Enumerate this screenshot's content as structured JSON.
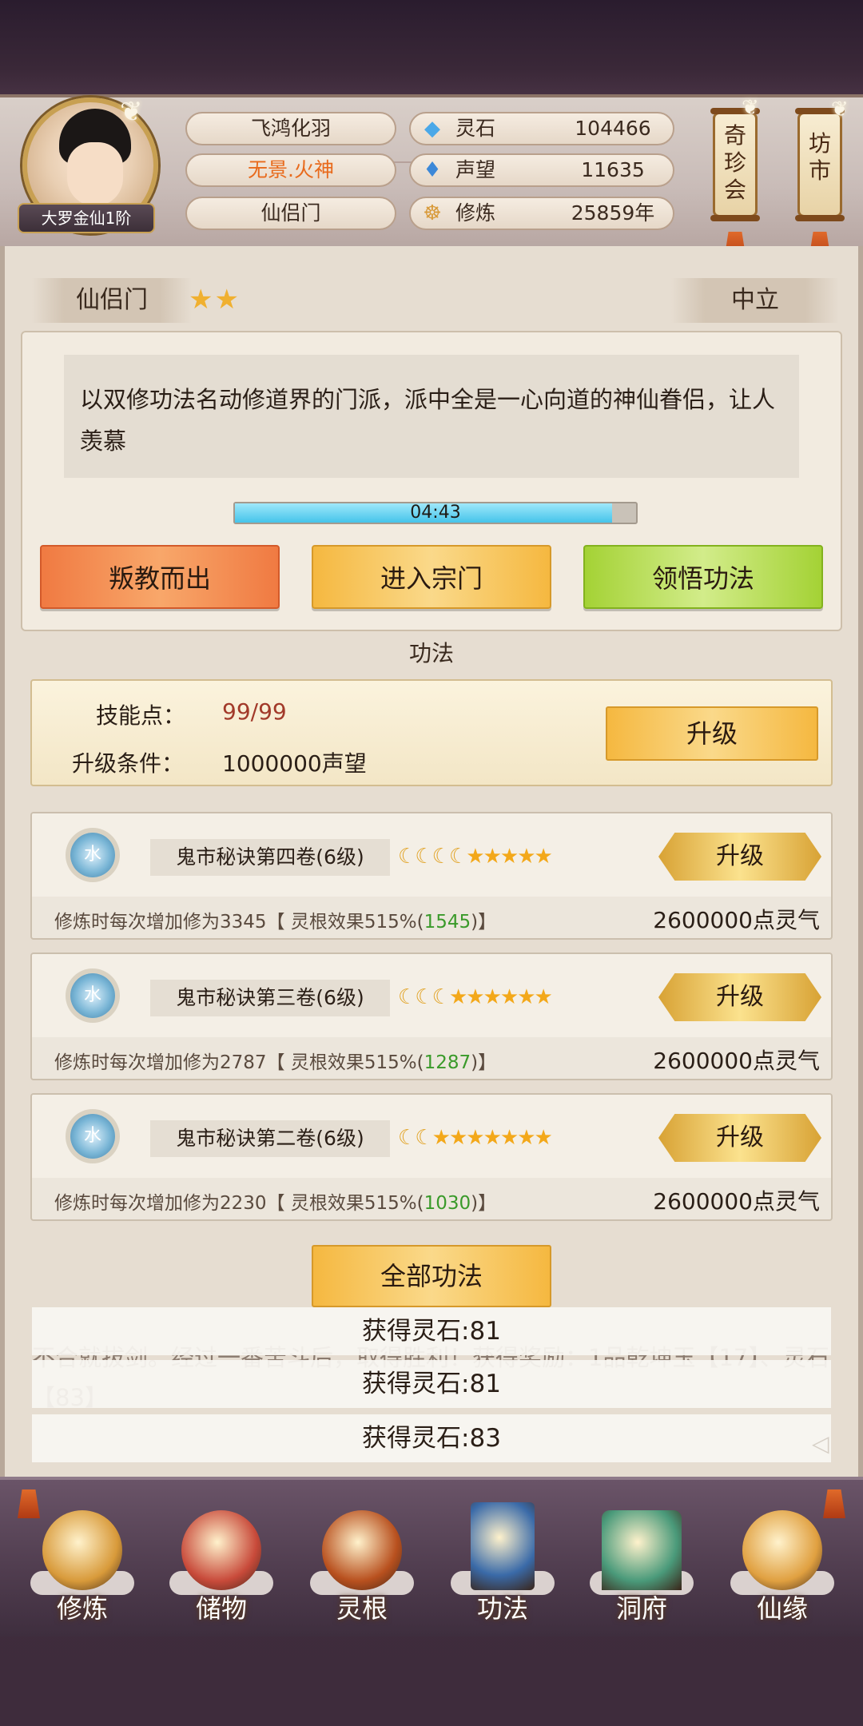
{
  "player": {
    "rank": "大罗金仙1阶",
    "title": "飞鸿化羽",
    "name": "无景.火神",
    "sect": "仙侣门"
  },
  "resources": [
    {
      "icon": "gem-icon",
      "label": "灵石",
      "value": "104466"
    },
    {
      "icon": "reputation-icon",
      "label": "声望",
      "value": "11635"
    },
    {
      "icon": "meditation-icon",
      "label": "修炼",
      "value": "25859年"
    }
  ],
  "side_buttons": {
    "treasure": "奇珍会",
    "market": "坊市"
  },
  "sect": {
    "name": "仙侣门",
    "stars": "★★",
    "alignment": "中立",
    "description": "以双修功法名动修道界的门派，派中全是一心向道的神仙眷侣，让人羡慕",
    "timer": "04:43",
    "progress": 0.94,
    "buttons": {
      "betray": "叛教而出",
      "enter": "进入宗门",
      "learn": "领悟功法"
    }
  },
  "gongfa": {
    "section_title": "功法",
    "skill_points_label": "技能点：",
    "skill_points_value": "99/99",
    "condition_label": "升级条件：",
    "condition_value": "1000000声望",
    "upgrade_label": "升级"
  },
  "techniques": [
    {
      "element": "水",
      "name": "鬼市秘诀第四卷(6级)",
      "moons": 4,
      "stars": 5,
      "upgrade": "升级",
      "desc_prefix": "修炼时每次增加修为3345【 灵根效果515%(",
      "desc_green": "1545",
      "desc_suffix": ")】",
      "cost": "2600000点灵气"
    },
    {
      "element": "水",
      "name": "鬼市秘诀第三卷(6级)",
      "moons": 3,
      "stars": 6,
      "upgrade": "升级",
      "desc_prefix": "修炼时每次增加修为2787【 灵根效果515%(",
      "desc_green": "1287",
      "desc_suffix": ")】",
      "cost": "2600000点灵气"
    },
    {
      "element": "水",
      "name": "鬼市秘诀第二卷(6级)",
      "moons": 2,
      "stars": 7,
      "upgrade": "升级",
      "desc_prefix": "修炼时每次增加修为2230【 灵根效果515%(",
      "desc_green": "1030",
      "desc_suffix": ")】",
      "cost": "2600000点灵气"
    }
  ],
  "all_gongfa": "全部功法",
  "log": "不合就拔剑。经过一番苦斗后，取得胜利！获得奖励：1品乾坤玉【17】、灵石【83】",
  "toasts": [
    "获得灵石:81",
    "获得灵石:81",
    "获得灵石:83"
  ],
  "nav": [
    {
      "label": "修炼",
      "icon": "cultivate-icon",
      "color": "#d89a3a"
    },
    {
      "label": "储物",
      "icon": "storage-bag-icon",
      "color": "#c84a3a"
    },
    {
      "label": "灵根",
      "icon": "spirit-root-icon",
      "color": "#b8501e"
    },
    {
      "label": "功法",
      "icon": "book-icon",
      "color": "#3a6aa8"
    },
    {
      "label": "洞府",
      "icon": "cave-mansion-icon",
      "color": "#4a9a7a"
    },
    {
      "label": "仙缘",
      "icon": "gourd-icon",
      "color": "#e0a040"
    }
  ]
}
